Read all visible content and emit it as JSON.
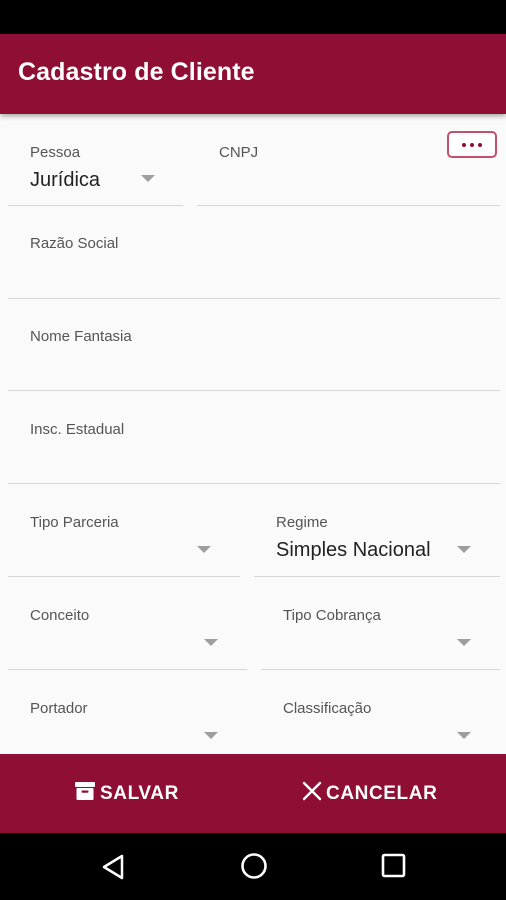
{
  "app_bar": {
    "title": "Cadastro de Cliente"
  },
  "form": {
    "pessoa": {
      "label": "Pessoa",
      "value": "Jurídica"
    },
    "cnpj": {
      "label": "CNPJ",
      "value": ""
    },
    "razao_social": {
      "label": "Razão Social",
      "value": ""
    },
    "nome_fantasia": {
      "label": "Nome Fantasia",
      "value": ""
    },
    "insc_estadual": {
      "label": "Insc. Estadual",
      "value": ""
    },
    "tipo_parceria": {
      "label": "Tipo Parceria",
      "value": ""
    },
    "regime": {
      "label": "Regime",
      "value": "Simples Nacional"
    },
    "conceito": {
      "label": "Conceito",
      "value": ""
    },
    "tipo_cobranca": {
      "label": "Tipo Cobrança",
      "value": ""
    },
    "portador": {
      "label": "Portador",
      "value": ""
    },
    "classificacao": {
      "label": "Classificação",
      "value": ""
    }
  },
  "actions": {
    "save_label": "SALVAR",
    "cancel_label": "CANCELAR"
  },
  "icons": {
    "more": "more-horizontal-icon",
    "save": "archive-icon",
    "cancel": "close-icon",
    "back": "nav-back-icon",
    "home": "nav-home-icon",
    "recents": "nav-recents-icon"
  },
  "colors": {
    "primary": "#8f0e33",
    "accent_border": "#c0506c"
  }
}
